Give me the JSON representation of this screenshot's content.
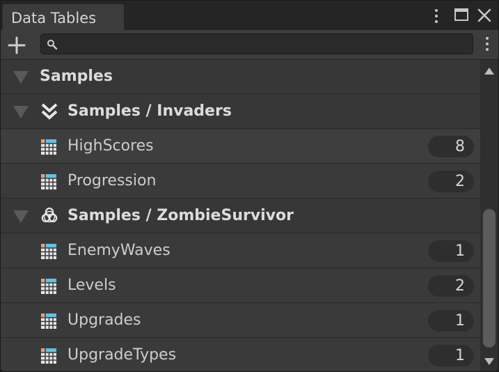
{
  "window": {
    "tab_title": "Data Tables",
    "buttons": [
      "kebab-menu",
      "maximize",
      "close"
    ]
  },
  "toolbar": {
    "add_icon": "plus-icon",
    "search": {
      "value": "",
      "placeholder": "",
      "icon": "search-icon"
    },
    "menu_icon": "kebab-icon"
  },
  "tree": {
    "root": {
      "label": "Samples",
      "icon": "triangle-down-icon"
    },
    "groups": [
      {
        "label": "Samples / Invaders",
        "icon": "double-chevron-down-icon",
        "items": [
          {
            "label": "HighScores",
            "count": "8"
          },
          {
            "label": "Progression",
            "count": "2"
          }
        ]
      },
      {
        "label": "Samples / ZombieSurvivor",
        "icon": "biohazard-icon",
        "items": [
          {
            "label": "EnemyWaves",
            "count": "1"
          },
          {
            "label": "Levels",
            "count": "2"
          },
          {
            "label": "Upgrades",
            "count": "1"
          },
          {
            "label": "UpgradeTypes",
            "count": "1"
          }
        ]
      }
    ]
  },
  "colors": {
    "background": "#383838",
    "tab_bar": "#252525",
    "badge": "#2e2e2e",
    "text": "#cdcdcd",
    "table_icon_header": "#5fc3e4",
    "table_icon_accent": "#e8a07a"
  }
}
